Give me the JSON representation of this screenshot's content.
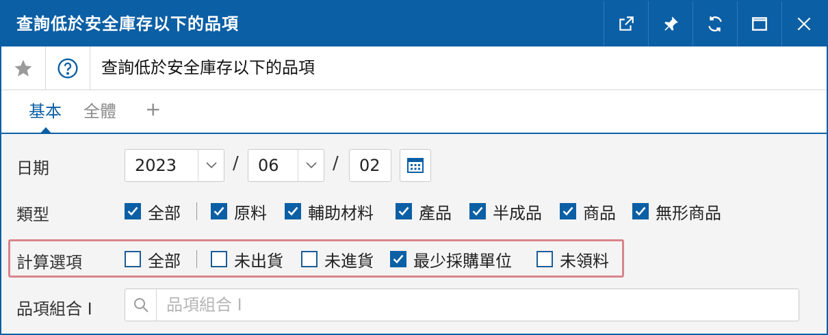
{
  "window": {
    "title": "查詢低於安全庫存以下的品項"
  },
  "header": {
    "title": "查詢低於安全庫存以下的品項"
  },
  "tabs": [
    {
      "label": "基本"
    },
    {
      "label": "全體"
    },
    {
      "label": "+"
    }
  ],
  "date": {
    "label": "日期",
    "year": "2023",
    "month": "06",
    "day": "02",
    "separator": "/"
  },
  "type": {
    "label": "類型",
    "options": [
      {
        "label": "全部",
        "checked": true
      },
      {
        "label": "原料",
        "checked": true
      },
      {
        "label": "輔助材料",
        "checked": true
      },
      {
        "label": "產品",
        "checked": true
      },
      {
        "label": "半成品",
        "checked": true
      },
      {
        "label": "商品",
        "checked": true
      },
      {
        "label": "無形商品",
        "checked": true
      }
    ]
  },
  "calc": {
    "label": "計算選項",
    "options": [
      {
        "label": "全部",
        "checked": false
      },
      {
        "label": "未出貨",
        "checked": false
      },
      {
        "label": "未進貨",
        "checked": false
      },
      {
        "label": "最少採購單位",
        "checked": true
      },
      {
        "label": "未領料",
        "checked": false
      }
    ]
  },
  "item_group": {
    "label": "品項組合 I",
    "placeholder": "品項組合 I",
    "value": ""
  },
  "colors": {
    "brand": "#0b5fa5",
    "highlight": "#d9848c"
  }
}
